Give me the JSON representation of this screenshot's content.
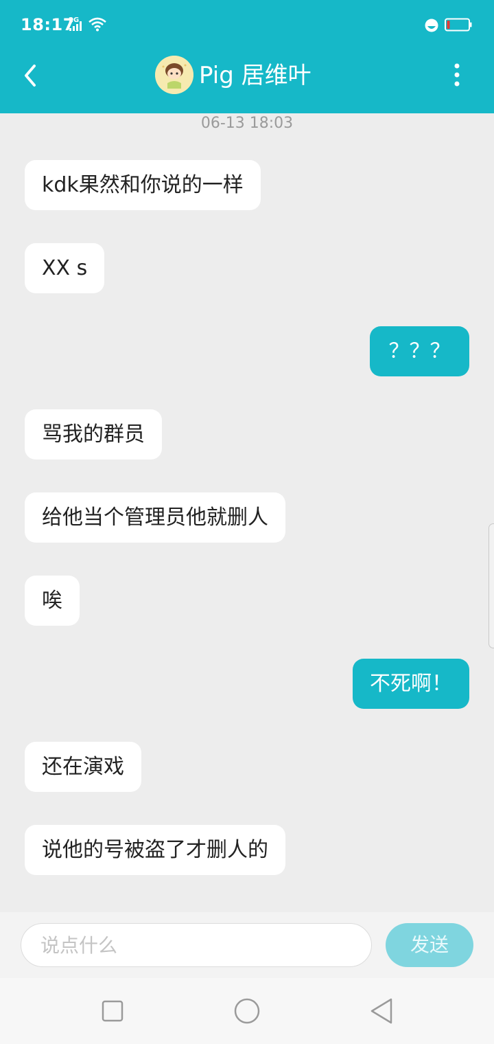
{
  "status_bar": {
    "time": "18:17",
    "network": "2G",
    "icons": [
      "signal-icon",
      "wifi-icon",
      "do-not-disturb-icon",
      "battery-low-icon"
    ]
  },
  "header": {
    "title": "Pig 居维叶",
    "icons": [
      "back-arrow-icon",
      "avatar",
      "more-vertical-icon"
    ],
    "background": "#16b8c8"
  },
  "timestamp": "06-13 18:03",
  "messages": [
    {
      "side": "in",
      "text": "kdk果然和你说的一样"
    },
    {
      "side": "in",
      "text": "XX s"
    },
    {
      "side": "out",
      "text": "？？？"
    },
    {
      "side": "in",
      "text": "骂我的群员"
    },
    {
      "side": "in",
      "text": "给他当个管理员他就删人"
    },
    {
      "side": "in",
      "text": "唉"
    },
    {
      "side": "out",
      "text": "不死啊！"
    },
    {
      "side": "in",
      "text": "还在演戏"
    },
    {
      "side": "in",
      "text": "说他的号被盗了才删人的"
    }
  ],
  "input": {
    "placeholder": "说点什么",
    "value": "",
    "send_label": "发送"
  },
  "nav": {
    "icons": [
      "recent-apps-icon",
      "home-icon",
      "back-icon"
    ]
  }
}
